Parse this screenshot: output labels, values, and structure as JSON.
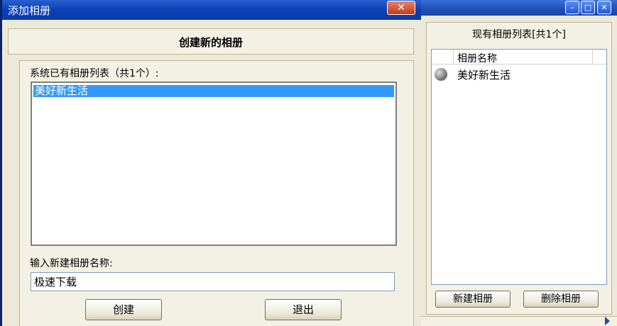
{
  "dialog": {
    "title": "添加相册",
    "close_glyph": "✕",
    "header": "创建新的相册",
    "existing_label": "系统已有相册列表（共1个）:",
    "existing_items": [
      "美好新生活"
    ],
    "name_label": "输入新建相册名称:",
    "name_value": "极速下载",
    "create_label": "创建",
    "exit_label": "退出"
  },
  "background_window": {
    "panel_title": "现有相册列表[共1个]",
    "column_header": "相册名称",
    "albums": [
      {
        "label": "美好新生活",
        "icon": "album-globe-icon"
      }
    ],
    "new_label": "新建相册",
    "delete_label": "删除相册",
    "minimize_glyph": "–",
    "maximize_glyph": "□",
    "close_glyph": "✕"
  },
  "colors": {
    "titlebar": "#0b3fb5",
    "selection": "#3399ff",
    "face": "#ece9d8"
  }
}
